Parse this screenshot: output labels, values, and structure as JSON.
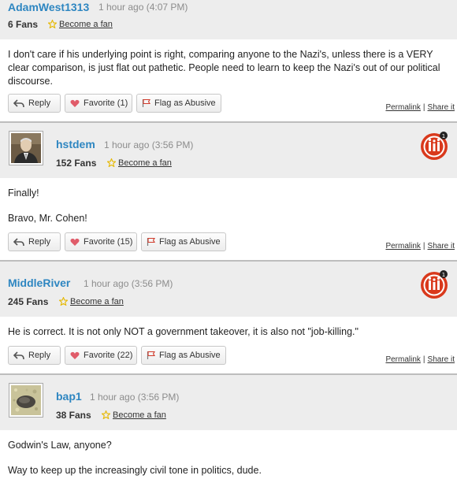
{
  "labels": {
    "become_fan": "Become a fan",
    "reply": "Reply",
    "flag": "Flag as Abusive",
    "permalink": "Permalink",
    "share": "Share it",
    "separator": "|"
  },
  "comments": [
    {
      "username": "AdamWest1313",
      "time": "1 hour ago (4:07 PM)",
      "fans": "6 Fans",
      "favorite": "Favorite (1)",
      "paragraphs": [
        "I don't care if his underlying point is right, comparing anyone to the Nazi's, unless there is a VERY clear comparison, is just flat out pathetic. People need to learn to keep the Nazi's out of our political discourse."
      ]
    },
    {
      "username": "hstdem",
      "time": "1 hour ago (3:56 PM)",
      "fans": "152 Fans",
      "favorite": "Favorite (15)",
      "paragraphs": [
        "Finally!",
        "Bravo, Mr. Cohen!"
      ]
    },
    {
      "username": "MiddleRiver",
      "time": "1 hour ago (3:56 PM)",
      "fans": "245 Fans",
      "favorite": "Favorite (22)",
      "paragraphs": [
        "He is correct. It is not only NOT a government takeover, it is also not \"job-killing.\""
      ]
    },
    {
      "username": "bap1",
      "time": "1 hour ago (3:56 PM)",
      "fans": "38 Fans",
      "paragraphs": [
        "Godwin's Law, anyone?",
        "Way to keep up the increasingly civil tone in politics, dude."
      ]
    }
  ],
  "colors": {
    "username": "#2e86c1",
    "header_bg": "#ededed",
    "badge_red": "#d9391c",
    "star": "#e6b800",
    "heart": "#e05c6a",
    "flag": "#d03a2a"
  },
  "icons": [
    "reply-arrow-icon",
    "heart-icon",
    "flag-icon",
    "star-icon",
    "superuser-badge-icon"
  ]
}
